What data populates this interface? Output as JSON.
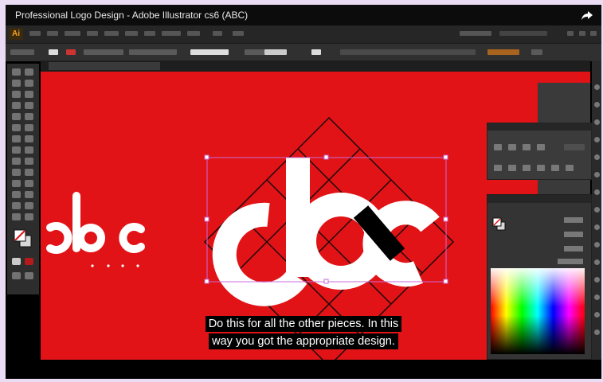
{
  "video": {
    "title": "Professional Logo Design - Adobe Illustrator cs6 (ABC)",
    "share_icon": "share-arrow-icon"
  },
  "app": {
    "logo_text": "Ai"
  },
  "subtitles": {
    "line1": "Do this for all the other pieces. In this",
    "line2": "way you got the appropriate design."
  },
  "colors": {
    "canvas_red": "#e11317",
    "panel_dark": "#343434"
  }
}
